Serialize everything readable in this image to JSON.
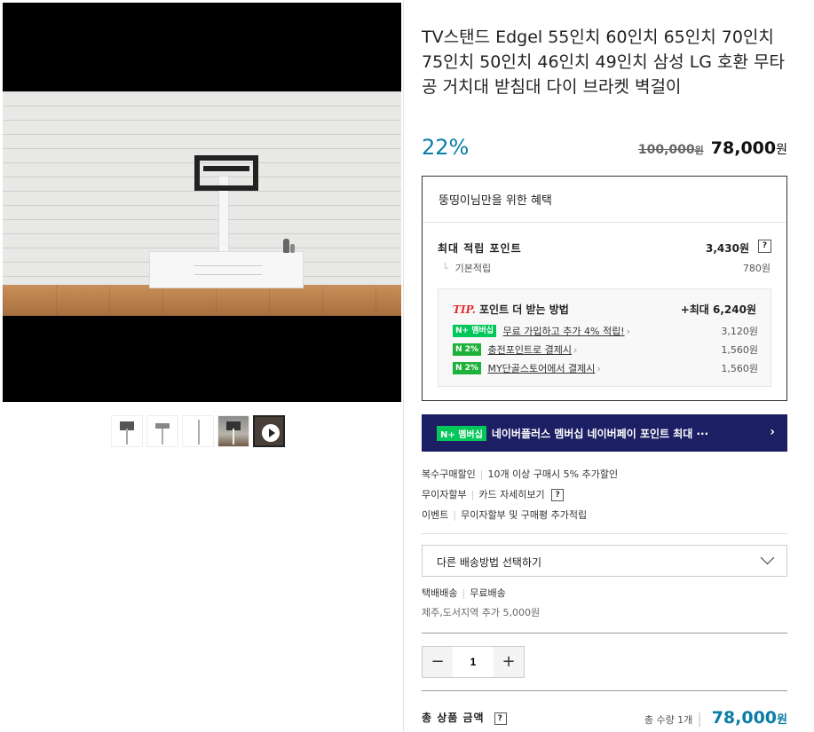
{
  "product": {
    "title": "TV스탠드 Edgel 55인치 60인치 65인치 70인치 75인치 50인치 46인치 49인치 삼성 LG 호환 무타공 거치대 받침대 다이 브라켓 벽걸이",
    "discount": "22%",
    "original_price": "100,000",
    "original_unit": "원",
    "sale_price": "78,000",
    "sale_unit": "원"
  },
  "benefit": {
    "header": "뚱띵이님만을 위한 혜택",
    "max_points_label": "최대 적립 포인트",
    "max_points_value": "3,430원",
    "help": "?",
    "base_label": "기본적립",
    "base_value": "780원",
    "tip_prefix": "TIP.",
    "tip_title": "포인트 더 받는 방법",
    "tip_max": "+최대 6,240원",
    "tips": [
      {
        "badge": "N+ 멤버십",
        "text": "무료 가입하고 추가 4% 적립!",
        "amount": "3,120원"
      },
      {
        "badge": "N 2%",
        "text": "충전포인트로 결제시",
        "amount": "1,560원"
      },
      {
        "badge": "N 2%",
        "text": "MY단골스토어에서 결제시",
        "amount": "1,560원"
      }
    ]
  },
  "banner": {
    "badge": "N+ 멤버십",
    "text": "네이버플러스 멤버십 네이버페이 포인트 최대 ···"
  },
  "info": {
    "multi_label": "복수구매할인",
    "multi_value": "10개 이상 구매시 5% 추가할인",
    "installment_label": "무이자할부",
    "installment_value": "카드 자세히보기",
    "event_label": "이벤트",
    "event_value": "무이자할부 및 구매평 추가적립"
  },
  "shipping": {
    "select_label": "다른 배송방법 선택하기",
    "method": "택배배송",
    "fee": "무료배송",
    "extra": "제주,도서지역 추가 5,000원"
  },
  "order": {
    "quantity": "1",
    "minus": "−",
    "plus": "+",
    "total_label": "총 상품 금액",
    "total_qty": "총 수량 1개",
    "total_price": "78,000",
    "total_unit": "원"
  },
  "colors": {
    "accent": "#0a7da6",
    "banner": "#1c1f63",
    "naver_green": "#03c75a",
    "tip_red": "#e62f2f"
  }
}
